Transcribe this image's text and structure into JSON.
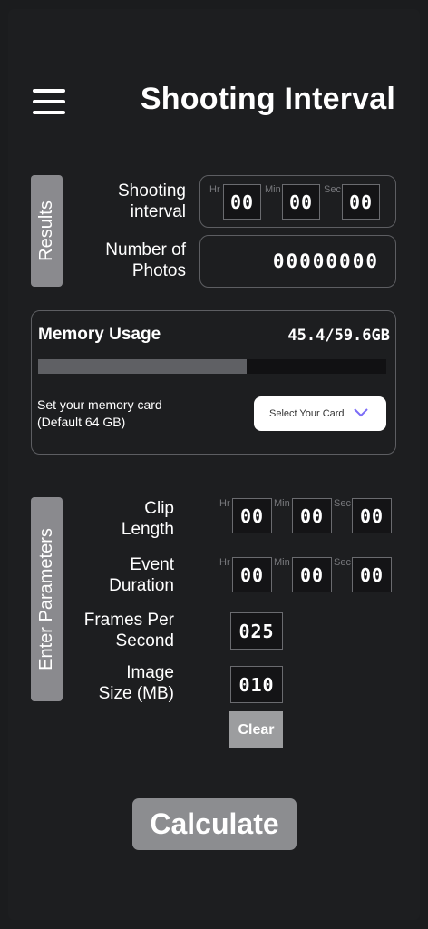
{
  "header": {
    "title": "Shooting Interval",
    "menu_icon": "hamburger-menu-icon"
  },
  "results": {
    "tab_label": "Results",
    "shooting_interval": {
      "label_line1": "Shooting",
      "label_line2": "interval",
      "units": [
        "Hr",
        "Min",
        "Sec"
      ],
      "values": [
        "00",
        "00",
        "00"
      ]
    },
    "number_of_photos": {
      "label_line1": "Number of",
      "label_line2": "Photos",
      "value": "00000000"
    }
  },
  "memory": {
    "title": "Memory Usage",
    "value": "45.4/59.6GB",
    "usage_fraction": 0.6,
    "note_line1": "Set your memory card",
    "note_line2": "(Default 64 GB)",
    "select_label": "Select Your Card",
    "chevron_color": "#7b6cf6"
  },
  "parameters": {
    "tab_label": "Enter Parameters",
    "clip_length": {
      "label_line1": "Clip",
      "label_line2": "Length",
      "units": [
        "Hr",
        "Min",
        "Sec"
      ],
      "values": [
        "00",
        "00",
        "00"
      ]
    },
    "event_duration": {
      "label_line1": "Event",
      "label_line2": "Duration",
      "units": [
        "Hr",
        "Min",
        "Sec"
      ],
      "values": [
        "00",
        "00",
        "00"
      ]
    },
    "fps": {
      "label_line1": "Frames Per",
      "label_line2": "Second",
      "value": "025"
    },
    "image_size": {
      "label_line1": "Image",
      "label_line2": "Size (MB)",
      "value": "010"
    },
    "clear_label": "Clear"
  },
  "calculate_label": "Calculate"
}
